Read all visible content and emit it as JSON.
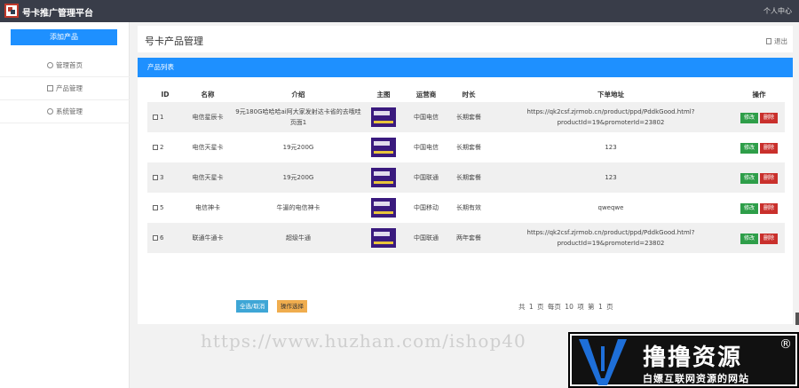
{
  "app": {
    "title": "号卡推广管理平台",
    "user_center": "个人中心"
  },
  "sidebar": {
    "add_button": "添加产品",
    "items": [
      {
        "label": "管理首页",
        "icon": "home-icon"
      },
      {
        "label": "产品管理",
        "icon": "edit-icon"
      },
      {
        "label": "系统管理",
        "icon": "user-icon"
      }
    ]
  },
  "header": {
    "title": "号卡产品管理",
    "logout": "退出"
  },
  "card": {
    "title": "产品列表"
  },
  "table": {
    "headers": [
      "ID",
      "名称",
      "介绍",
      "主图",
      "运营商",
      "时长",
      "下单地址",
      "操作"
    ],
    "rows": [
      {
        "id": "1",
        "name": "电信星辰卡",
        "intro": "9元180G哈哈哈ai阿大家发射达卡省的去哦哇",
        "intro2": "页面1",
        "carrier": "中国电信",
        "duration": "长期套餐",
        "url": "https://qk2csf.zjrmob.cn/product/ppd/PddkGood.html?productId=19&promoterId=23802"
      },
      {
        "id": "2",
        "name": "电信天星卡",
        "intro": "19元200G",
        "intro2": "",
        "carrier": "中国电信",
        "duration": "长期套餐",
        "url": "123"
      },
      {
        "id": "3",
        "name": "电信天星卡",
        "intro": "19元200G",
        "intro2": "",
        "carrier": "中国联通",
        "duration": "长期套餐",
        "url": "123"
      },
      {
        "id": "5",
        "name": "电信神卡",
        "intro": "牛逼的电信神卡",
        "intro2": "",
        "carrier": "中国移动",
        "duration": "长期有效",
        "url": "qweqwe"
      },
      {
        "id": "6",
        "name": "联通牛通卡",
        "intro": "超级牛通",
        "intro2": "",
        "carrier": "中国联通",
        "duration": "两年套餐",
        "url": "https://qk2csf.zjrmob.cn/product/ppd/PddkGood.html?productId=19&promoterId=23802"
      }
    ],
    "edit_label": "修改",
    "delete_label": "删除"
  },
  "footer": {
    "select_all": "全选/取消",
    "invert": "操作选择",
    "pager": "共 1 页 每页 10 项 第 1 页"
  },
  "watermark": {
    "url": "https://www.huzhan.com/ishop40",
    "brand_title": "撸撸资源",
    "brand_sub": "白嫖互联网资源的网站",
    "reg": "®"
  },
  "colors": {
    "accent": "#1e90ff",
    "topbar": "#393d49",
    "edit": "#2e9e49",
    "delete": "#c9302c"
  }
}
